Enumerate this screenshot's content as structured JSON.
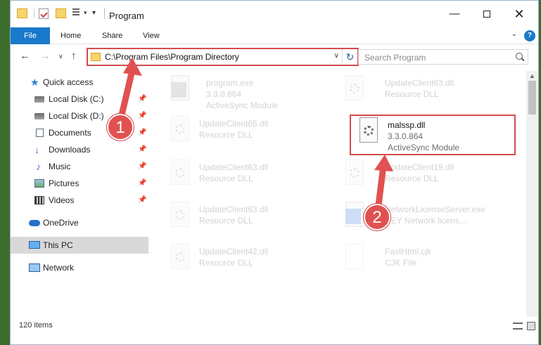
{
  "titlebar": {
    "title": "Program",
    "minimize": "—",
    "close": "✕",
    "qa_arrow": "▾",
    "qa_drop": "▾"
  },
  "ribbon": {
    "tabs": [
      "File",
      "Home",
      "Share",
      "View"
    ],
    "expand": "⌄",
    "help": "?"
  },
  "navigation": {
    "back": "←",
    "forward": "→",
    "recent": "∨",
    "up": "↑"
  },
  "address": {
    "path": "C:\\Program Files\\Program Directory",
    "dropdown": "∨",
    "refresh": "↻"
  },
  "search": {
    "placeholder": "Search Program"
  },
  "sidebar": {
    "items": [
      {
        "label": "Quick access",
        "pinned": false
      },
      {
        "label": "Local Disk (C:)",
        "pinned": true
      },
      {
        "label": "Local Disk (D:)",
        "pinned": true
      },
      {
        "label": "Documents",
        "pinned": true
      },
      {
        "label": "Downloads",
        "pinned": true
      },
      {
        "label": "Music",
        "pinned": true
      },
      {
        "label": "Pictures",
        "pinned": true
      },
      {
        "label": "Videos",
        "pinned": true
      },
      {
        "label": "OneDrive",
        "pinned": false
      },
      {
        "label": "This PC",
        "pinned": false,
        "selected": true
      },
      {
        "label": "Network",
        "pinned": false
      }
    ],
    "pin_glyph": "📌"
  },
  "files": [
    {
      "name": "program.exe",
      "line2": "3.3.0.864",
      "line3": "ActiveSync Module",
      "faded": true
    },
    {
      "name": "UpdateClient63.dll",
      "line2": "Resource DLL",
      "faded": true
    },
    {
      "name": "UpdateClient65.dll",
      "line2": "Resource DLL",
      "faded": true
    },
    {
      "name": "malssp.dll",
      "line2": "3.3.0.864",
      "line3": "ActiveSync Module",
      "faded": false
    },
    {
      "name": "UpdateClient63.dll",
      "line2": "Resource DLL",
      "faded": true
    },
    {
      "name": "UpdateClient19.dll",
      "line2": "Resource DLL",
      "faded": true
    },
    {
      "name": "UpdateClient63.dll",
      "line2": "Resource DLL",
      "faded": true
    },
    {
      "name": "NetworkLicenseServer.exe",
      "line2": "HEY Network licens...",
      "faded": true
    },
    {
      "name": "UpdateClient42.dll",
      "line2": "Resource DLL",
      "faded": true
    },
    {
      "name": "FastHtml.cjk",
      "line2": "CJK File",
      "faded": true
    }
  ],
  "status": {
    "item_count": "120 items"
  },
  "annotations": {
    "callout_1": "1",
    "callout_2": "2",
    "color": "#e15151"
  },
  "colors": {
    "accent": "#1979ca",
    "highlight": "#d54b4b"
  }
}
